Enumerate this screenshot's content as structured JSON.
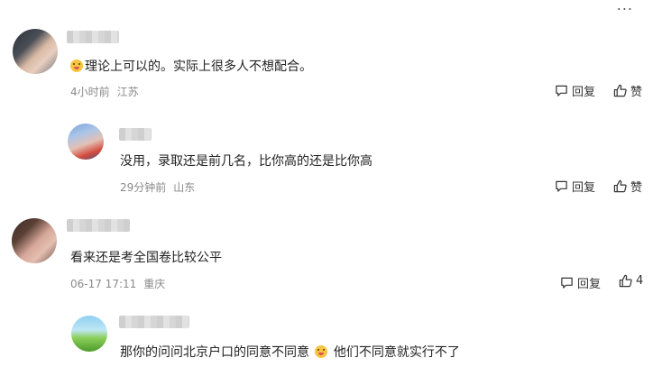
{
  "top": {
    "more_label": "..."
  },
  "comments": [
    {
      "text": "理论上可以的。实际上很多人不想配合。",
      "time": "4小时前",
      "location": "江苏",
      "reply_label": "回复",
      "like_label": "赞",
      "has_emoji_prefix": true
    },
    {
      "text": "没用，录取还是前几名，比你高的还是比你高",
      "time": "29分钟前",
      "location": "山东",
      "reply_label": "回复",
      "like_label": "赞"
    },
    {
      "text": "看来还是考全国卷比较公平",
      "time": "06-17 17:11",
      "location": "重庆",
      "reply_label": "回复",
      "like_label": "4"
    },
    {
      "text_before_emoji": "那你的问问北京户口的同意不同意",
      "text_after_emoji": "他们不同意就实行不了"
    }
  ],
  "icons": [
    "comment-icon",
    "thumb-up-icon",
    "tongue-face-emoji",
    "grinning-face-emoji"
  ]
}
